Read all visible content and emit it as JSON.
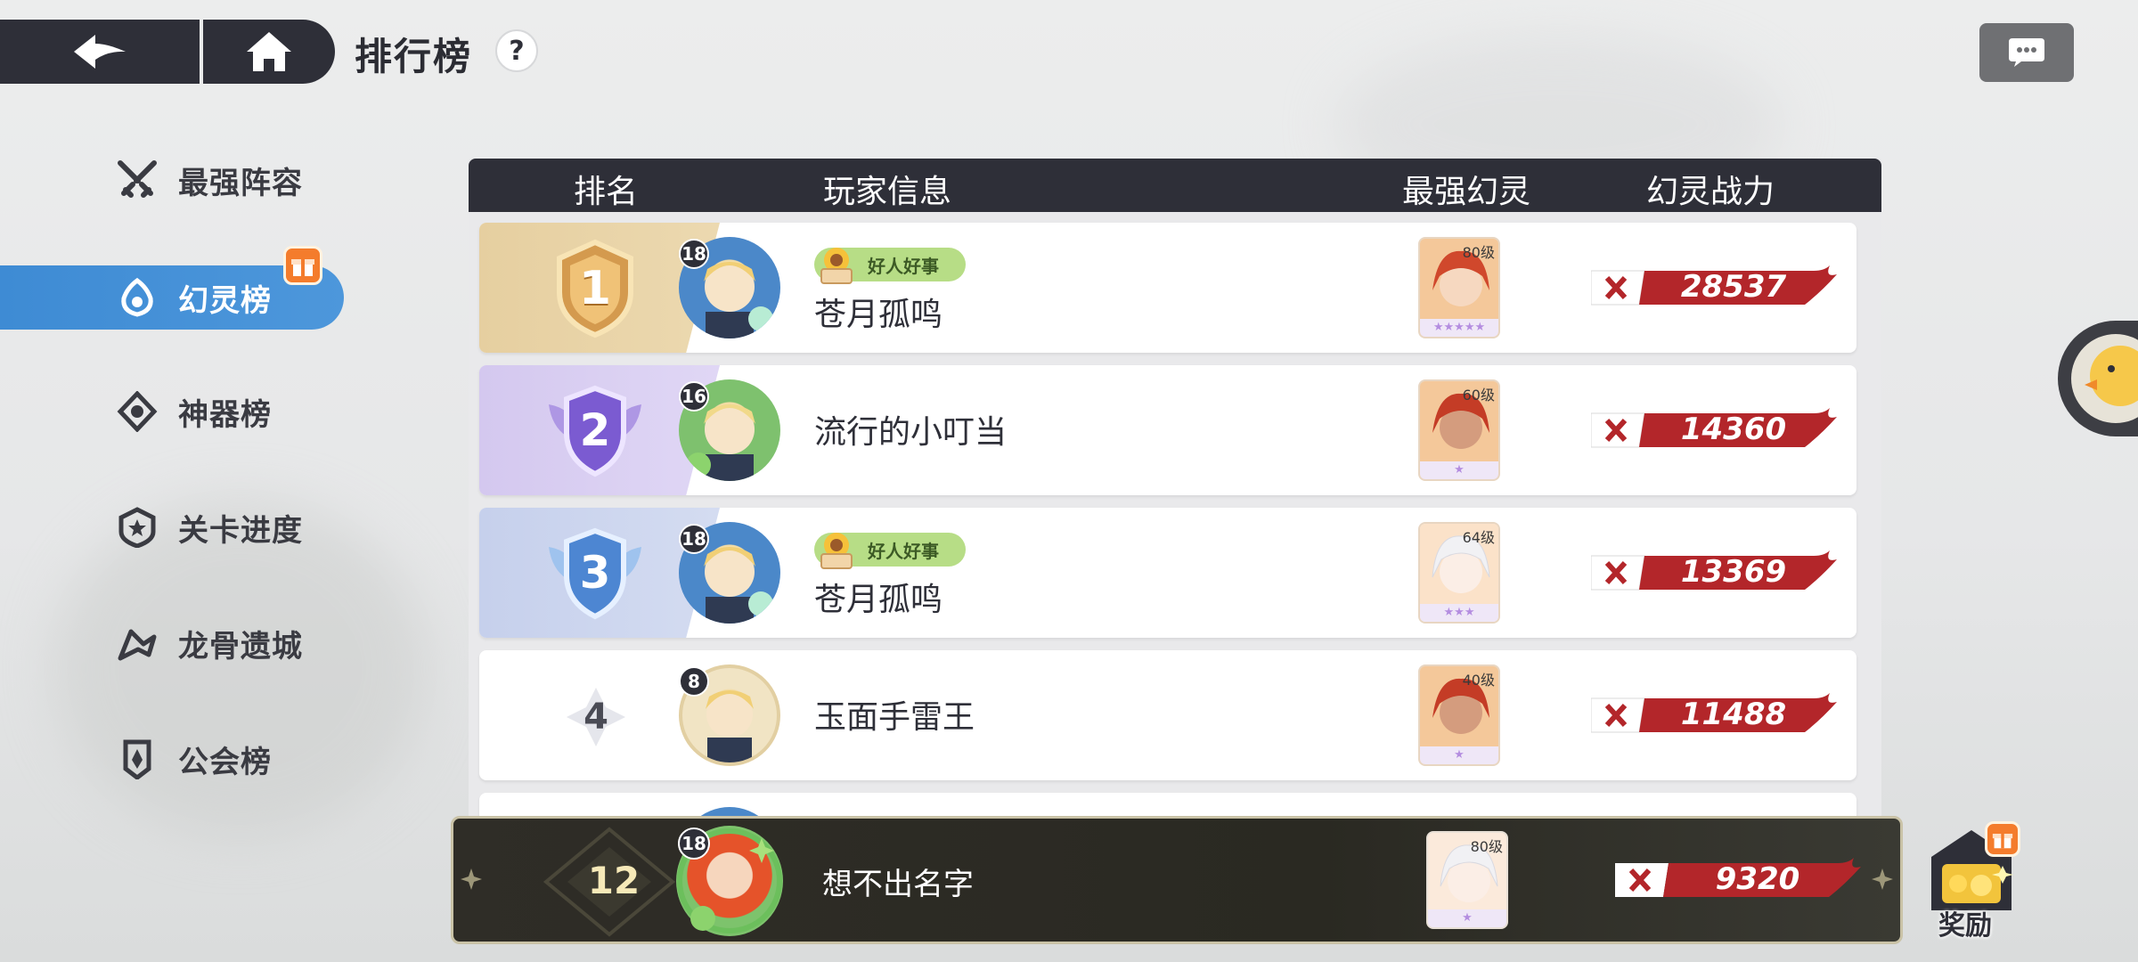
{
  "header": {
    "title": "排行榜",
    "help_label": "?"
  },
  "sidebar": {
    "items": [
      {
        "label": "最强阵容",
        "icon": "crossed-swords-icon"
      },
      {
        "label": "幻灵榜",
        "icon": "spirit-icon",
        "active": true
      },
      {
        "label": "神器榜",
        "icon": "artifact-icon"
      },
      {
        "label": "关卡进度",
        "icon": "star-shield-icon"
      },
      {
        "label": "龙骨遗城",
        "icon": "dragon-icon"
      },
      {
        "label": "公会榜",
        "icon": "guild-banner-icon"
      }
    ]
  },
  "table": {
    "headers": {
      "rank": "排名",
      "player": "玩家信息",
      "spirit": "最强幻灵",
      "power": "幻灵战力"
    },
    "rows": [
      {
        "rank": "1",
        "level": "18",
        "title": "好人好事",
        "name": "苍月孤鸣",
        "spirit_level": "80级",
        "stars": "★★★★★",
        "power": "28537"
      },
      {
        "rank": "2",
        "level": "16",
        "title": "",
        "name": "流行的小叮当",
        "spirit_level": "60级",
        "stars": "★",
        "power": "14360"
      },
      {
        "rank": "3",
        "level": "18",
        "title": "好人好事",
        "name": "苍月孤鸣",
        "spirit_level": "64级",
        "stars": "★★★",
        "power": "13369"
      },
      {
        "rank": "4",
        "level": "8",
        "title": "",
        "name": "玉面手雷王",
        "spirit_level": "40级",
        "stars": "★",
        "power": "11488"
      }
    ]
  },
  "self": {
    "rank": "12",
    "level": "18",
    "name": "想不出名字",
    "spirit_level": "80级",
    "stars": "★",
    "power": "9320"
  },
  "reward": {
    "label": "奖励"
  },
  "colors": {
    "dark": "#2e2f38",
    "active_blue": "#4690d8",
    "power_red": "#b3262a",
    "gold": "#e2c48c",
    "purple": "#c7b8ea",
    "blue": "#c2cdea"
  }
}
